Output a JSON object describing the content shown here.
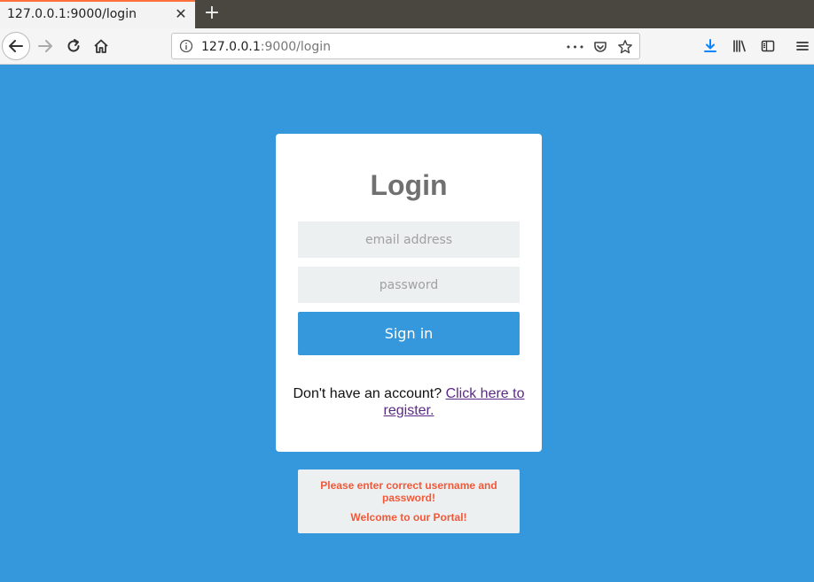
{
  "browser": {
    "tab_title": "127.0.0.1:9000/login",
    "url_host": "127.0.0.1",
    "url_rest": ":9000/login",
    "tab_close": "✕",
    "new_tab": "+",
    "url_more": "•••"
  },
  "login": {
    "title": "Login",
    "email_placeholder": "email address",
    "password_placeholder": "password",
    "signin_label": "Sign in",
    "register_prompt": "Don't have an account? ",
    "register_link": "Click here to register."
  },
  "messages": {
    "error": "Please enter correct username and password!",
    "welcome": "Welcome to our Portal!"
  },
  "colors": {
    "page_bg": "#3598dc",
    "error_text": "#f0593a",
    "link": "#5b2a86"
  }
}
